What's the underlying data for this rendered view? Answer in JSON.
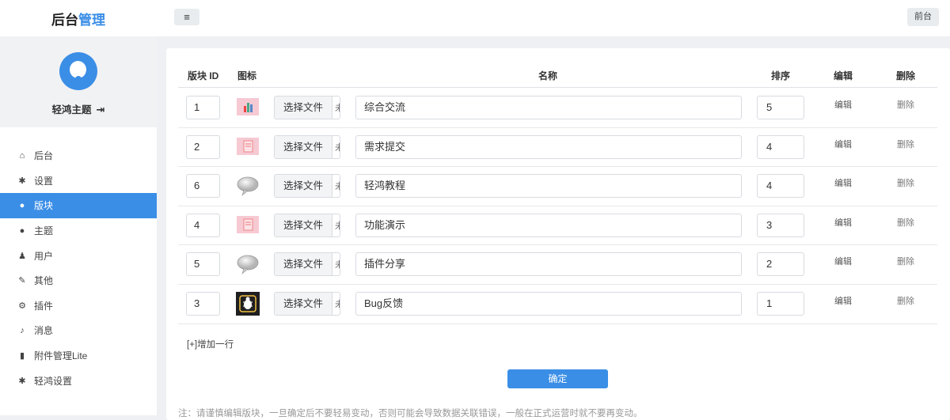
{
  "header": {
    "brand_prefix": "后台",
    "brand_accent": "管理",
    "menu_toggle": "≡",
    "front_label": "前台"
  },
  "sidebar": {
    "username": "轻鸿主题",
    "logout_glyph": "⇥",
    "items": [
      {
        "label": "后台",
        "icon": "home-icon",
        "glyph": "⌂",
        "active": false
      },
      {
        "label": "设置",
        "icon": "gear-icon",
        "glyph": "✱",
        "active": false
      },
      {
        "label": "版块",
        "icon": "comment-icon",
        "glyph": "●",
        "active": true
      },
      {
        "label": "主题",
        "icon": "comment-icon",
        "glyph": "●",
        "active": false
      },
      {
        "label": "用户",
        "icon": "user-icon",
        "glyph": "♟",
        "active": false
      },
      {
        "label": "其他",
        "icon": "wrench-icon",
        "glyph": "✎",
        "active": false
      },
      {
        "label": "插件",
        "icon": "cogs-icon",
        "glyph": "⚙",
        "active": false
      },
      {
        "label": "消息",
        "icon": "bell-icon",
        "glyph": "♪",
        "active": false
      },
      {
        "label": "附件管理Lite",
        "icon": "file-icon",
        "glyph": "▮",
        "active": false
      },
      {
        "label": "轻鸿设置",
        "icon": "gear-icon",
        "glyph": "✱",
        "active": false
      }
    ]
  },
  "table": {
    "headers": {
      "id": "版块 ID",
      "icon": "图标",
      "name": "名称",
      "order": "排序",
      "edit": "编辑",
      "delete": "删除"
    },
    "file_button": "选择文件",
    "file_rest": "未",
    "edit_label": "编辑",
    "delete_label": "删除",
    "rows": [
      {
        "id": "1",
        "name": "综合交流",
        "order": "5",
        "icon": "pink-chart-thumb"
      },
      {
        "id": "2",
        "name": "需求提交",
        "order": "4",
        "icon": "pink-doc-thumb"
      },
      {
        "id": "6",
        "name": "轻鸿教程",
        "order": "4",
        "icon": "speech-bubble-thumb"
      },
      {
        "id": "4",
        "name": "功能演示",
        "order": "3",
        "icon": "pink-doc-thumb"
      },
      {
        "id": "5",
        "name": "插件分享",
        "order": "2",
        "icon": "speech-bubble-thumb"
      },
      {
        "id": "3",
        "name": "Bug反馈",
        "order": "1",
        "icon": "bug-thumb"
      }
    ]
  },
  "add_row_label": "[+]增加一行",
  "confirm_label": "确定",
  "note": "注：请谨慎编辑版块，一旦确定后不要轻易变动，否则可能会导致数据关联错误，一般在正式运营时就不要再变动。"
}
